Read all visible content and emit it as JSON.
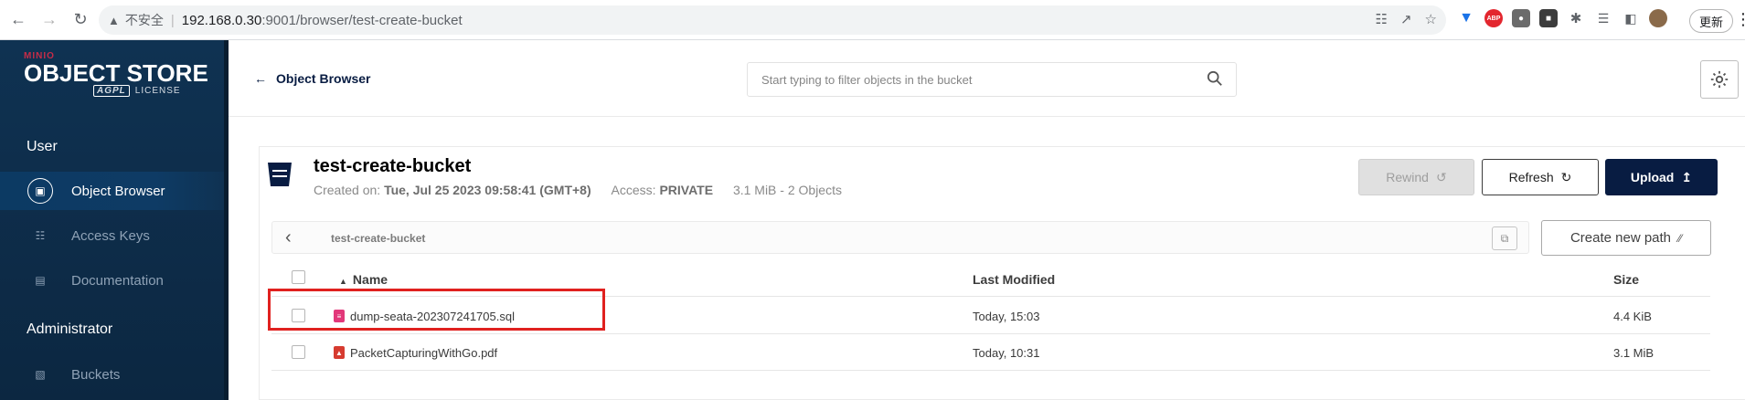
{
  "browser": {
    "insecure_label": "不安全",
    "url_host": "192.168.0.30",
    "url_path": ":9001/browser/test-create-bucket",
    "update_label": "更新"
  },
  "sidebar": {
    "logo": {
      "brand": "MINIO",
      "product": "OBJECT STORE",
      "badge": "AGPL",
      "license": "LICENSE"
    },
    "user_section": "User",
    "admin_section": "Administrator",
    "items": [
      {
        "label": "Object Browser",
        "icon": "object-browser-icon",
        "active": true
      },
      {
        "label": "Access Keys",
        "icon": "access-keys-icon",
        "active": false
      },
      {
        "label": "Documentation",
        "icon": "documentation-icon",
        "active": false
      },
      {
        "label": "Buckets",
        "icon": "buckets-icon",
        "active": false
      }
    ]
  },
  "header": {
    "back_label": "Object Browser",
    "search_placeholder": "Start typing to filter objects in the bucket"
  },
  "bucket": {
    "name": "test-create-bucket",
    "created_label": "Created on:",
    "created_value": "Tue, Jul 25 2023 09:58:41 (GMT+8)",
    "access_label": "Access:",
    "access_value": "PRIVATE",
    "usage": "3.1 MiB - 2 Objects"
  },
  "actions": {
    "rewind": "Rewind",
    "refresh": "Refresh",
    "upload": "Upload",
    "new_path": "Create new path"
  },
  "breadcrumb": {
    "path": "test-create-bucket"
  },
  "table": {
    "columns": {
      "name": "Name",
      "modified": "Last Modified",
      "size": "Size"
    },
    "rows": [
      {
        "name": "dump-seata-202307241705.sql",
        "modified": "Today, 15:03",
        "size": "4.4 KiB",
        "type": "sql",
        "color": "#e2387a",
        "highlighted": true
      },
      {
        "name": "PacketCapturingWithGo.pdf",
        "modified": "Today, 10:31",
        "size": "3.1 MiB",
        "type": "pdf",
        "color": "#d63b30",
        "highlighted": false
      }
    ]
  },
  "colors": {
    "sidebar": "#0f3252",
    "accent": "#081c42",
    "highlight": "#e0211f"
  }
}
